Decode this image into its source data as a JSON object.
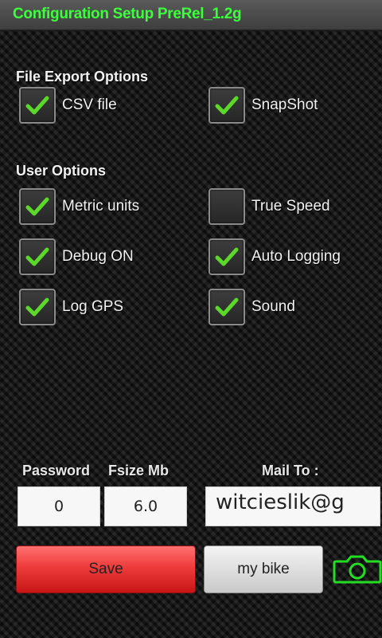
{
  "title": "Configuration Setup PreRel_1.2g",
  "file_export": {
    "heading": "File Export Options",
    "options": [
      {
        "label": "CSV file",
        "checked": true
      },
      {
        "label": "SnapShot",
        "checked": true
      }
    ]
  },
  "user_options": {
    "heading": "User Options",
    "options": [
      {
        "label": "Metric units",
        "checked": true
      },
      {
        "label": "True Speed",
        "checked": false
      },
      {
        "label": "Debug ON",
        "checked": true
      },
      {
        "label": "Auto Logging",
        "checked": true
      },
      {
        "label": "Log GPS",
        "checked": true
      },
      {
        "label": "Sound",
        "checked": true
      }
    ]
  },
  "fields": {
    "password_label": "Password",
    "password_value": "0",
    "fsize_label": "Fsize Mb",
    "fsize_value": "6.0",
    "mail_label": "Mail To :",
    "mail_value": "witcieslik@g"
  },
  "buttons": {
    "save": "Save",
    "my_bike": "my bike"
  },
  "icons": {
    "checkmark": "check-icon",
    "camera": "camera-icon"
  },
  "colors": {
    "title_text": "#3cff3c",
    "check": "#5cd82a",
    "save_button": "#e53333",
    "camera_outline": "#22dd22"
  }
}
